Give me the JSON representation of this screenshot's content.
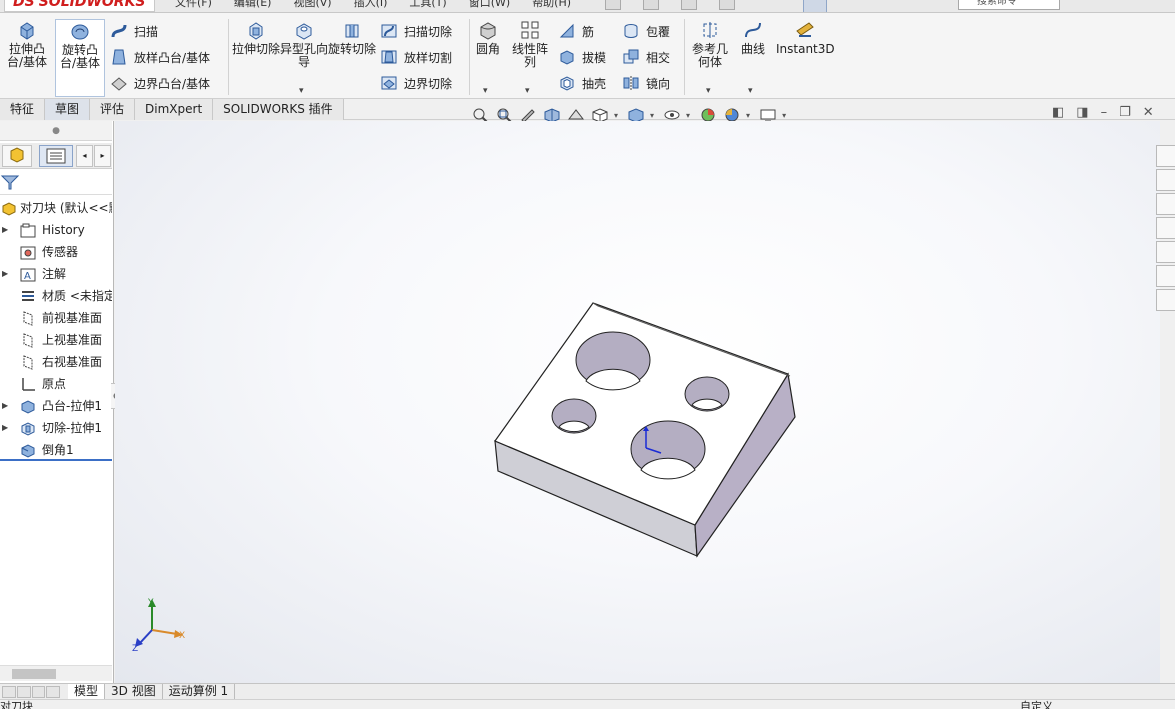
{
  "app": {
    "logo_text": "SOLIDWORKS",
    "logo_prefix": "DS"
  },
  "menus": [
    "文件(F)",
    "编辑(E)",
    "视图(V)",
    "插入(I)",
    "工具(T)",
    "窗口(W)",
    "帮助(H)"
  ],
  "search": {
    "placeholder": "搜索命令"
  },
  "ribbon": {
    "extrude_boss": "拉伸凸台/基体",
    "revolve_boss": "旋转凸台/基体",
    "sweep": "扫描",
    "loft_boss": "放样凸台/基体",
    "boundary_boss": "边界凸台/基体",
    "extrude_cut": "拉伸切除",
    "hole_wizard": "异型孔向导",
    "revolve_cut": "旋转切除",
    "sweep_cut": "扫描切除",
    "loft_cut": "放样切割",
    "boundary_cut": "边界切除",
    "fillet": "圆角",
    "linear_pattern": "线性阵列",
    "rib": "筋",
    "draft": "拔模",
    "shell": "抽壳",
    "wrap": "包覆",
    "intersect": "相交",
    "mirror": "镜向",
    "ref_geometry": "参考几何体",
    "curves": "曲线",
    "instant3d": "Instant3D"
  },
  "tabs": [
    "特征",
    "草图",
    "评估",
    "DimXpert",
    "SOLIDWORKS 插件"
  ],
  "tree": {
    "root": "对刀块 (默认<<默认>",
    "items": [
      {
        "label": "History",
        "icon": "history-folder-icon",
        "expandable": true
      },
      {
        "label": "传感器",
        "icon": "sensor-icon",
        "expandable": false
      },
      {
        "label": "注解",
        "icon": "annotation-icon",
        "expandable": true
      },
      {
        "label": "材质 <未指定>",
        "icon": "material-icon",
        "expandable": false
      },
      {
        "label": "前视基准面",
        "icon": "plane-icon",
        "expandable": false
      },
      {
        "label": "上视基准面",
        "icon": "plane-icon",
        "expandable": false
      },
      {
        "label": "右视基准面",
        "icon": "plane-icon",
        "expandable": false
      },
      {
        "label": "原点",
        "icon": "origin-icon",
        "expandable": false
      },
      {
        "label": "凸台-拉伸1",
        "icon": "boss-extrude-icon",
        "expandable": true
      },
      {
        "label": "切除-拉伸1",
        "icon": "cut-extrude-icon",
        "expandable": true
      },
      {
        "label": "倒角1",
        "icon": "chamfer-icon",
        "expandable": false
      }
    ]
  },
  "triad": {
    "x": "X",
    "y": "Y",
    "z": "Z"
  },
  "bottom_tabs": [
    "模型",
    "3D 视图",
    "运动算例 1"
  ],
  "status": {
    "left": "对刀块",
    "right": "自定义"
  },
  "colors": {
    "accent": "#3b6fc6",
    "logo_red": "#d01e1e",
    "part_side": "#b8b0c6"
  }
}
